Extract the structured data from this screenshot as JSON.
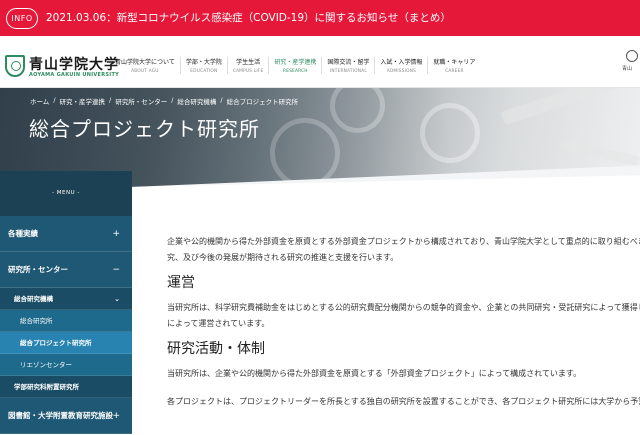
{
  "alert": {
    "pill": "INFO",
    "text": "2021.03.06：新型コロナウイルス感染症（COVID-19）に関するお知らせ（まとめ）"
  },
  "header": {
    "logo_name": "青山学院大学",
    "logo_sub": "AOYAMA GAKUIN UNIVERSITY",
    "nav": [
      {
        "jp": "青山学院大学について",
        "en": "ABOUT AGU"
      },
      {
        "jp": "学部・大学院",
        "en": "EDUCATION"
      },
      {
        "jp": "学生生活",
        "en": "CAMPUS LIFE"
      },
      {
        "jp": "研究・産学連携",
        "en": "RESEARCH"
      },
      {
        "jp": "国際交流・留学",
        "en": "INTERNATIONAL"
      },
      {
        "jp": "入試・入学情報",
        "en": "ADMISSIONS"
      },
      {
        "jp": "就職・キャリア",
        "en": "CAREER"
      }
    ],
    "right_label": "青山"
  },
  "breadcrumb": [
    "ホーム",
    "研究・産学連携",
    "研究所・センター",
    "総合研究機構",
    "総合プロジェクト研究所"
  ],
  "page_title": "総合プロジェクト研究所",
  "sidebar": {
    "head": "- MENU -",
    "items": [
      {
        "label": "各種実績",
        "toggle": "+"
      },
      {
        "label": "研究所・センター",
        "toggle": "−"
      }
    ],
    "sub": {
      "label": "総合研究機構",
      "toggle": "⌄"
    },
    "subsub": [
      "総合研究所",
      "総合プロジェクト研究所",
      "リエゾンセンター"
    ],
    "sub2": "学部研究科附置研究所",
    "last": {
      "label": "図書館・大学附置教育研究施設",
      "toggle": "+"
    }
  },
  "content": {
    "intro_1": "企業や公的機関から得た外部資金を原資とする外部資金プロジェクトから構成されており、青山学院大学として重点的に取り組むべき",
    "intro_2": "究、及び今後の発展が期待される研究の推進と支援を行います。",
    "h_operation": "運営",
    "op_1": "当研究所は、科学研究費補助金をはじめとする公的研究費配分機関からの競争的資金や、企業との共同研究・受託研究によって獲得し",
    "op_2": "によって運営されています。",
    "h_research": "研究活動・体制",
    "res_1": "当研究所は、企業や公的機関から得た外部資金を原資とする「外部資金プロジェクト」によって構成されています。",
    "res_2": "各プロジェクトは、プロジェクトリーダーを所長とする独自の研究所を設置することができ、各プロジェクト研究所には大学から予算"
  }
}
